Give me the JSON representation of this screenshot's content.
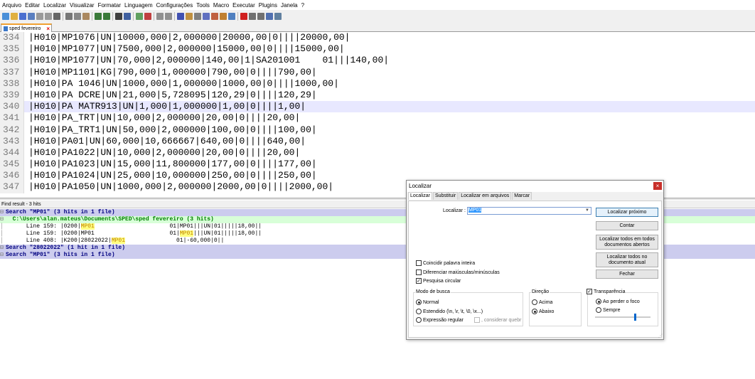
{
  "menu": [
    "Arquivo",
    "Editar",
    "Localizar",
    "Visualizar",
    "Formatar",
    "Linguagem",
    "Configurações",
    "Tools",
    "Macro",
    "Executar",
    "Plugins",
    "Janela",
    "?"
  ],
  "toolbar_icons": [
    "new-file-icon",
    "open-file-icon",
    "save-icon",
    "save-all-icon",
    "close-icon",
    "close-all-icon",
    "print-icon",
    "cut-icon",
    "copy-icon",
    "paste-icon",
    "undo-icon",
    "redo-icon",
    "find-icon",
    "replace-icon",
    "zoom-in-icon",
    "zoom-out-icon",
    "sync-v-icon",
    "sync-h-icon",
    "wrap-icon",
    "all-chars-icon",
    "indent-guide-icon",
    "doc-map-icon",
    "function-list-icon",
    "folder-workspace-icon",
    "monitor-icon",
    "record-macro-icon",
    "stop-record-icon",
    "play-macro-icon",
    "run-macro-icon",
    "save-macro-icon"
  ],
  "tab": {
    "label": "sped fevereiro"
  },
  "editor": {
    "lines": [
      {
        "n": "334",
        "text": "|H010|MP1076|UN|10000,000|2,000000|20000,00|0||||20000,00|"
      },
      {
        "n": "335",
        "text": "|H010|MP1077|UN|7500,000|2,000000|15000,00|0||||15000,00|"
      },
      {
        "n": "336",
        "text": "|H010|MP1077|UN|70,000|2,000000|140,00|1|SA201001    01|||140,00|"
      },
      {
        "n": "337",
        "text": "|H010|MP1101|KG|790,000|1,000000|790,00|0||||790,00|"
      },
      {
        "n": "338",
        "text": "|H010|PA 1046|UN|1000,000|1,000000|1000,00|0||||1000,00|"
      },
      {
        "n": "339",
        "text": "|H010|PA DCRE|UN|21,000|5,728095|120,29|0||||120,29|"
      },
      {
        "n": "340",
        "text": "|H010|PA MATR913|UN|1,000|1,000000|1,00|0||||1,00|",
        "current": true
      },
      {
        "n": "341",
        "text": "|H010|PA_TRT|UN|10,000|2,000000|20,00|0||||20,00|"
      },
      {
        "n": "342",
        "text": "|H010|PA_TRT1|UN|50,000|2,000000|100,00|0||||100,00|"
      },
      {
        "n": "343",
        "text": "|H010|PA01|UN|60,000|10,666667|640,00|0||||640,00|"
      },
      {
        "n": "344",
        "text": "|H010|PA1022|UN|10,000|2,000000|20,00|0||||20,00|"
      },
      {
        "n": "345",
        "text": "|H010|PA1023|UN|15,000|11,800000|177,00|0||||177,00|"
      },
      {
        "n": "346",
        "text": "|H010|PA1024|UN|25,000|10,000000|250,00|0||||250,00|"
      },
      {
        "n": "347",
        "text": "|H010|PA1050|UN|1000,000|2,000000|2000,00|0||||2000,00|"
      }
    ]
  },
  "find_result": {
    "header": "Find result - 3 hits",
    "rows": [
      {
        "type": "search",
        "text": "Search \"MP01\" (3 hits in 1 file)"
      },
      {
        "type": "file",
        "text": "  C:\\Users\\alan.mateus\\Documents\\SPED\\sped fevereiro (3 hits)"
      },
      {
        "type": "hit",
        "pre": "      Line 159: |0200|",
        "hl": "MP01",
        "post": "                      01|MP01|||UN|01|||||18,00||"
      },
      {
        "type": "hit2",
        "pre": "      Line 159: |0200|MP01                      01|",
        "hl": "MP01",
        "post": "|||UN|01|||||18,00||"
      },
      {
        "type": "hit",
        "pre": "      Line 408: |K200|28022022|",
        "hl": "MP01",
        "post": "               01|-60,000|0||"
      },
      {
        "type": "search",
        "text": "Search \"28022022\" (1 hit in 1 file)"
      },
      {
        "type": "search",
        "text": "Search \"MP01\" (3 hits in 1 file)"
      }
    ]
  },
  "dialog": {
    "title": "Localizar",
    "close": "×",
    "tabs": [
      "Localizar",
      "Substituir",
      "Localizar em arquivos",
      "Marcar"
    ],
    "find_label": "Localizar :",
    "find_value": "MP01",
    "buttons": {
      "find_next": "Localizar próximo",
      "count": "Contar",
      "find_all_open": "Localizar todos em todos documentos abertos",
      "find_all_current": "Localizar todos no documento atual",
      "close": "Fechar"
    },
    "options": {
      "whole_word": {
        "label": "Coincidir palavra inteira",
        "checked": false
      },
      "match_case": {
        "label": "Diferenciar maiúsculas/minúsculas",
        "checked": false
      },
      "wrap": {
        "label": "Pesquisa circular",
        "checked": true
      }
    },
    "search_mode": {
      "title": "Modo de busca",
      "normal": "Normal",
      "extended": "Estendido  (\\n, \\r, \\t, \\0, \\x...)",
      "regex": "Expressão regular",
      "dot_newline": ", considerar quebr",
      "selected": "Normal"
    },
    "direction": {
      "title": "Direção",
      "up": "Acima",
      "down": "Abaixo",
      "selected": "Abaixo"
    },
    "transparency": {
      "label": "Transparência",
      "checked": true,
      "on_lose_focus": "Ao perder o foco",
      "always": "Sempre",
      "selected": "Ao perder o foco",
      "level": 0.7
    }
  }
}
